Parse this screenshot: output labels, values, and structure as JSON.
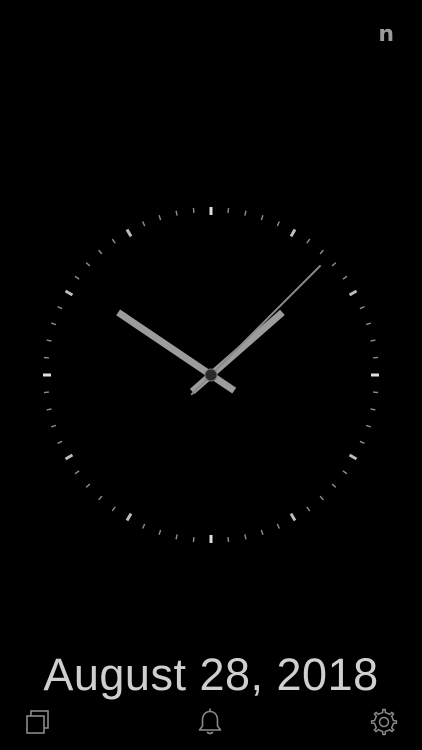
{
  "header": {
    "badge_text": "n"
  },
  "clock": {
    "time": {
      "hours": 10,
      "minutes": 8,
      "seconds": 7.5
    },
    "tick_color": "#bdbdbd",
    "hour_hand_color": "#9c9c9c",
    "minute_hand_color": "#9c9c9c",
    "second_hand_color": "#8a8a8a"
  },
  "date": {
    "text": "August 28, 2018"
  },
  "toolbar": {
    "left_icon": "pages-icon",
    "center_icon": "bell-icon",
    "right_icon": "gear-icon",
    "icon_color": "#8a8a8a"
  }
}
